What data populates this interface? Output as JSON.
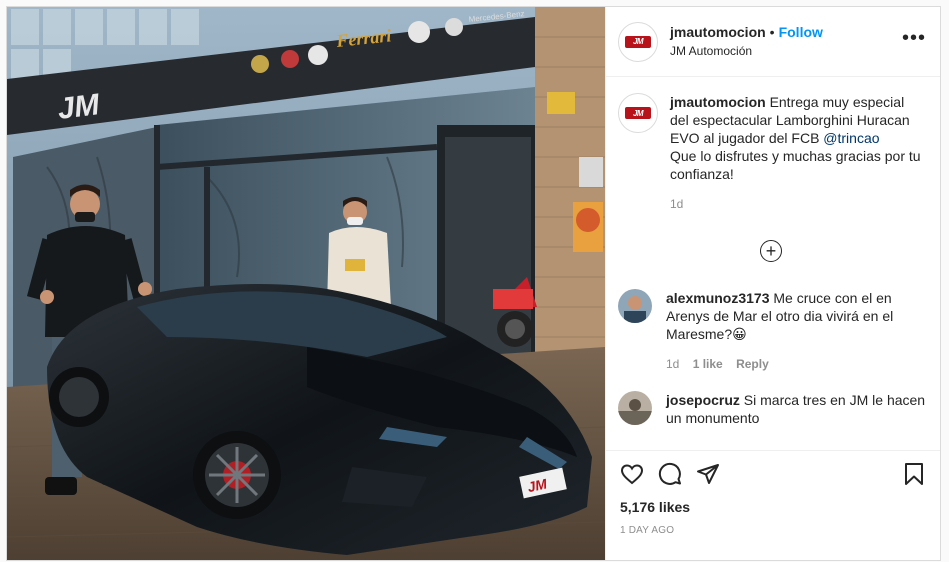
{
  "post": {
    "photo_alt": "",
    "storefront_brands": [
      "Ferrari",
      "Mercedes-Benz"
    ],
    "storefront_sign": "JM",
    "plate": "JM"
  },
  "header": {
    "username": "jmautomocion",
    "separator": "•",
    "follow_label": "Follow",
    "subtitle": "JM Automoción",
    "more_label": "•••",
    "avatar_logo": "JM"
  },
  "caption": {
    "username": "jmautomocion",
    "text_before": "Entrega muy especial del espectacular Lamborghini Huracan EVO al jugador del FCB ",
    "mention": "@trincao",
    "text_after": "Que lo disfrutes y muchas gracias por tu confianza!",
    "time": "1d"
  },
  "comments": [
    {
      "username": "alexmunoz3173",
      "text": "Me cruce con el en Arenys de Mar el otro dia vivirá en el Maresme?😀",
      "time": "1d",
      "likes": "1 like",
      "reply_label": "Reply"
    },
    {
      "username": "josepocruz",
      "text": "Si marca tres en JM le hacen un monumento"
    }
  ],
  "load_more_label": "+",
  "actions": {
    "likes_count": "5,176 likes",
    "time_ago": "1 DAY AGO"
  },
  "colors": {
    "follow": "#0095f6",
    "mention": "#00376b",
    "muted": "#8e8e8e",
    "brand_red": "#b8121b"
  }
}
